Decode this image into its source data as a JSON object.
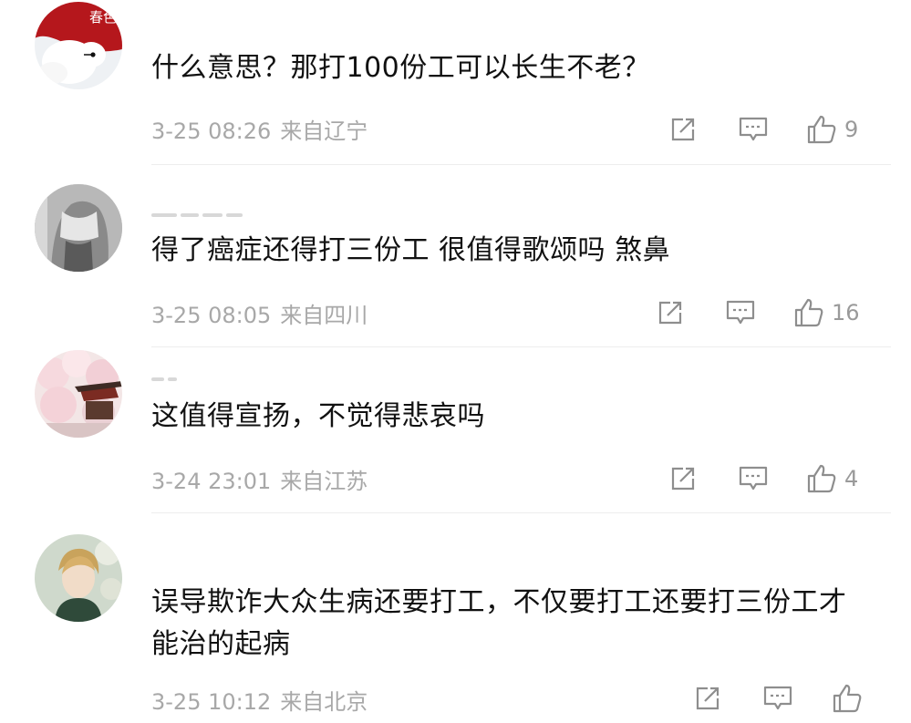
{
  "comments": [
    {
      "text": "什么意思？那打100份工可以长生不老？",
      "date": "3-25 08:26",
      "location": "来自辽宁",
      "likes": "9",
      "avatar_caption": "春色"
    },
    {
      "text": "得了癌症还得打三份工 很值得歌颂吗  煞鼻",
      "date": "3-25 08:05",
      "location": "来自四川",
      "likes": "16"
    },
    {
      "text": "这值得宣扬，不觉得悲哀吗",
      "date": "3-24 23:01",
      "location": "来自江苏",
      "likes": "4"
    },
    {
      "text": "误导欺诈大众生病还要打工，不仅要打工还要打三份工才能治的起病",
      "date": "3-25 10:12",
      "location": "来自北京",
      "likes": ""
    }
  ],
  "icons": {
    "share": "share-icon",
    "comment": "comment-icon",
    "like": "thumbs-up-icon"
  },
  "colors": {
    "text": "#111111",
    "meta": "#a8a8a8",
    "icon": "#8e8e8e",
    "divider": "#ededed",
    "avatar1_red": "#b5171c"
  }
}
